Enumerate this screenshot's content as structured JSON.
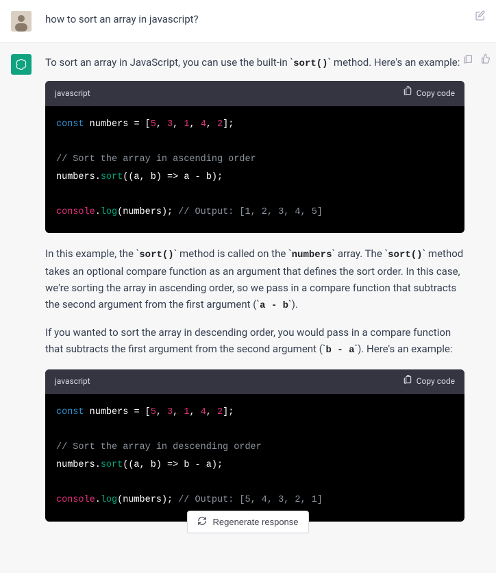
{
  "user": {
    "question": "how to sort an array in javascript?"
  },
  "edit_label": "Edit",
  "copy_label": "Copy",
  "like_label": "Like",
  "assistant": {
    "intro_prefix": "To sort an array in JavaScript, you can use the built-in ",
    "intro_code": "sort()",
    "intro_suffix": " method. Here's an example:",
    "code1": {
      "lang": "javascript",
      "copy": "Copy code",
      "kw_const": "const",
      "var_numbers": " numbers ",
      "eq_open": "= [",
      "n1": "5",
      "c1": ", ",
      "n2": "3",
      "c2": ", ",
      "n3": "1",
      "c3": ", ",
      "n4": "4",
      "c4": ", ",
      "n5": "2",
      "close_arr": "];",
      "cmt1": "// Sort the array in ascending order",
      "call_prefix": "numbers.",
      "fn_sort": "sort",
      "call_args": "((a, b) => a - b);",
      "console": "console",
      "dot": ".",
      "log": "log",
      "log_args": "(numbers);",
      "out_cmt": " // Output: [1, 2, 3, 4, 5]"
    },
    "p1_a": "In this example, the ",
    "p1_c1": "sort()",
    "p1_b": " method is called on the ",
    "p1_c2": "numbers",
    "p1_c": " array. The ",
    "p1_c3": "sort()",
    "p1_d": " method takes an optional compare function as an argument that defines the sort order. In this case, we're sorting the array in ascending order, so we pass in a compare function that subtracts the second argument from the first argument (",
    "p1_c4": "a - b",
    "p1_e": ").",
    "p2_a": "If you wanted to sort the array in descending order, you would pass in a compare function that subtracts the first argument from the second argument (",
    "p2_c1": "b - a",
    "p2_b": "). Here's an example:",
    "code2": {
      "lang": "javascript",
      "copy": "Copy code",
      "kw_const": "const",
      "var_numbers": " numbers ",
      "eq_open": "= [",
      "n1": "5",
      "c1": ", ",
      "n2": "3",
      "c2": ", ",
      "n3": "1",
      "c3": ", ",
      "n4": "4",
      "c4": ", ",
      "n5": "2",
      "close_arr": "];",
      "cmt1": "// Sort the array in descending order",
      "call_prefix": "numbers.",
      "fn_sort": "sort",
      "call_args": "((a, b) => b - a);",
      "console": "console",
      "dot": ".",
      "log": "log",
      "log_args": "(numbers);",
      "out_cmt": " // Output: [5, 4, 3, 2, 1]"
    }
  },
  "regen": "Regenerate response"
}
